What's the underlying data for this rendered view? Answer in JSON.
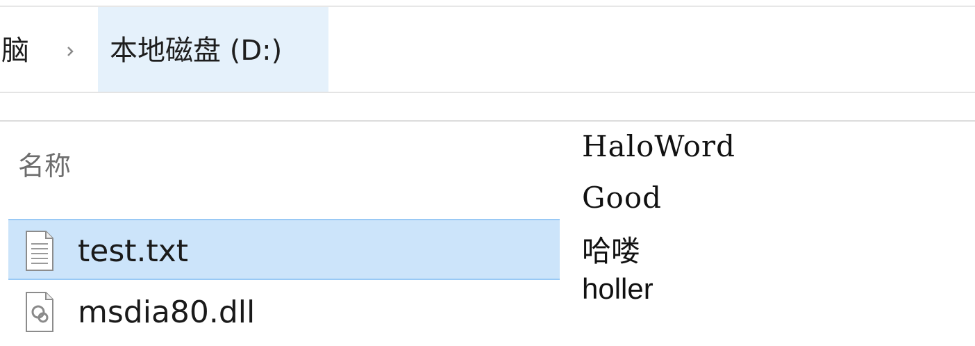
{
  "breadcrumb": {
    "prev_label": "脑",
    "current_label": "本地磁盘 (D:)"
  },
  "file_list": {
    "column_header": "名称",
    "files": [
      {
        "name": "test.txt",
        "icon": "text-file-icon",
        "selected": true
      },
      {
        "name": "msdia80.dll",
        "icon": "dll-file-icon",
        "selected": false
      }
    ]
  },
  "output_text": {
    "lines": [
      "HaloWord",
      "Good",
      "哈喽",
      "holler"
    ]
  },
  "colors": {
    "selection_bg": "#cce4fa",
    "selection_border": "#99c9f5",
    "breadcrumb_active_bg": "#e5f1fb",
    "header_text": "#6d6d6d"
  }
}
